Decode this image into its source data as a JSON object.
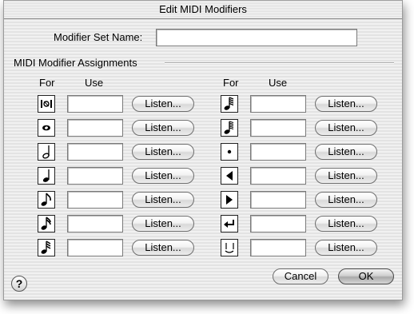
{
  "window": {
    "title": "Edit MIDI Modifiers"
  },
  "name_field": {
    "label": "Modifier Set Name:",
    "value": ""
  },
  "group": {
    "title": "MIDI Modifier Assignments"
  },
  "columns": {
    "for": "For",
    "use": "Use"
  },
  "listen_label": "Listen...",
  "left_rows": [
    {
      "icon": "all-notes-icon",
      "value": ""
    },
    {
      "icon": "whole-note-icon",
      "value": ""
    },
    {
      "icon": "half-note-icon",
      "value": ""
    },
    {
      "icon": "quarter-note-icon",
      "value": ""
    },
    {
      "icon": "eighth-note-icon",
      "value": ""
    },
    {
      "icon": "sixteenth-note-icon",
      "value": ""
    },
    {
      "icon": "thirty-second-note-icon",
      "value": ""
    }
  ],
  "right_rows": [
    {
      "icon": "sixty-fourth-note-icon",
      "value": ""
    },
    {
      "icon": "one-twenty-eighth-note-icon",
      "value": ""
    },
    {
      "icon": "dot-icon",
      "value": ""
    },
    {
      "icon": "step-back-icon",
      "value": ""
    },
    {
      "icon": "step-forward-icon",
      "value": ""
    },
    {
      "icon": "return-icon",
      "value": ""
    },
    {
      "icon": "tie-icon",
      "value": ""
    }
  ],
  "buttons": {
    "cancel": "Cancel",
    "ok": "OK"
  },
  "help": {
    "label": "?"
  }
}
